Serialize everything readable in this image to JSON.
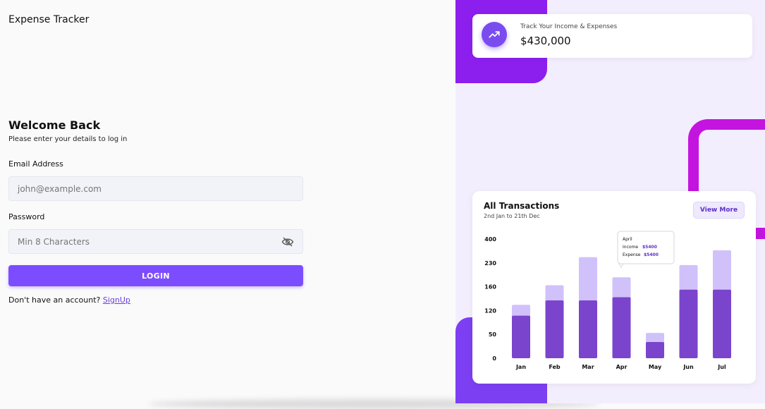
{
  "app": {
    "title": "Expense Tracker"
  },
  "login": {
    "heading": "Welcome Back",
    "subheading": "Please enter your details to log in",
    "email_label": "Email Address",
    "email_placeholder": "john@example.com",
    "password_label": "Password",
    "password_placeholder": "Min 8 Characters",
    "login_button": "LOGIN",
    "signup_prompt": "Don't have an account?",
    "signup_link": "SignUp"
  },
  "summary_card": {
    "label": "Track Your Income & Expenses",
    "amount": "$430,000",
    "icon": "trending-up-icon"
  },
  "transactions": {
    "title": "All Transactions",
    "date_range": "2nd Jan to 21th Dec",
    "view_more": "View More",
    "tooltip": {
      "month": "April",
      "income_label": "Income",
      "income_value": "$5400",
      "expense_label": "Expense",
      "expense_value": "$5400"
    }
  },
  "colors": {
    "accent": "#7c4dff",
    "bar_dark": "#7a44cd",
    "bar_light": "#d1c1fa",
    "deco_purple": "#8c1fee",
    "deco_magenta": "#c414e0"
  },
  "chart_data": {
    "type": "bar",
    "stacked": true,
    "categories": [
      "Jan",
      "Feb",
      "Mar",
      "Apr",
      "May",
      "Jun",
      "Jul"
    ],
    "y_tick_labels": [
      "0",
      "50",
      "120",
      "160",
      "230",
      "400"
    ],
    "series": [
      {
        "values": [
          118,
          160,
          160,
          169,
          45,
          190,
          190
        ]
      },
      {
        "values": [
          148,
          202,
          280,
          224,
          70,
          258,
          299
        ]
      }
    ],
    "grid": false,
    "legend": "none"
  }
}
